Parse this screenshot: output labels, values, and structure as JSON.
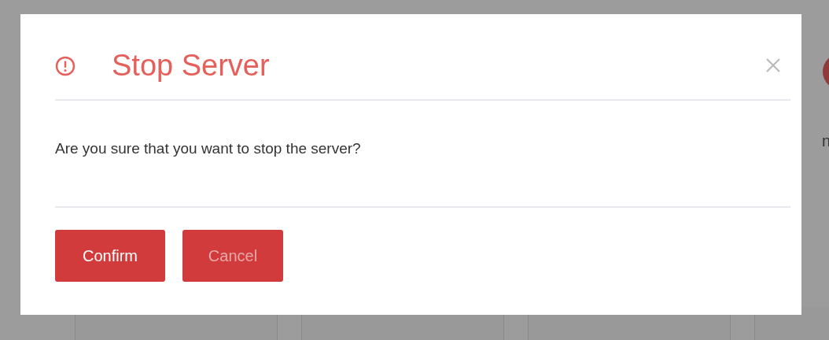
{
  "background": {
    "partial_text": "n"
  },
  "dialog": {
    "title": "Stop Server",
    "message": "Are you sure that you want to stop the server?",
    "buttons": [
      {
        "label": "Confirm",
        "kind": "primary"
      },
      {
        "label": "Cancel",
        "kind": "muted"
      }
    ]
  }
}
